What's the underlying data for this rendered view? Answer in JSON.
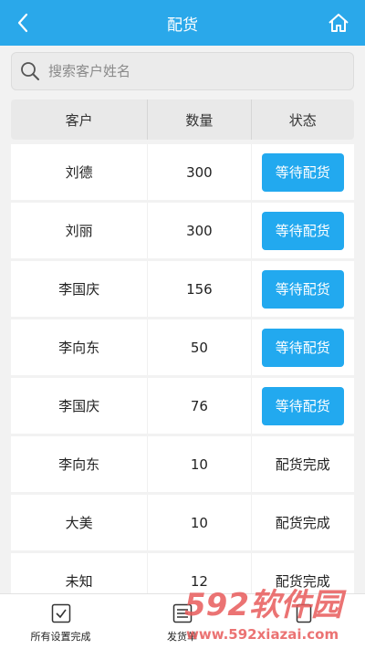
{
  "header": {
    "title": "配货"
  },
  "search": {
    "placeholder": "搜索客户姓名",
    "value": ""
  },
  "table": {
    "columns": [
      "客户",
      "数量",
      "状态"
    ],
    "rows": [
      {
        "customer": "刘德",
        "qty": "300",
        "status": "等待配货",
        "is_button": true
      },
      {
        "customer": "刘丽",
        "qty": "300",
        "status": "等待配货",
        "is_button": true
      },
      {
        "customer": "李国庆",
        "qty": "156",
        "status": "等待配货",
        "is_button": true
      },
      {
        "customer": "李向东",
        "qty": "50",
        "status": "等待配货",
        "is_button": true
      },
      {
        "customer": "李国庆",
        "qty": "76",
        "status": "等待配货",
        "is_button": true
      },
      {
        "customer": "李向东",
        "qty": "10",
        "status": "配货完成",
        "is_button": false
      },
      {
        "customer": "大美",
        "qty": "10",
        "status": "配货完成",
        "is_button": false
      },
      {
        "customer": "未知",
        "qty": "12",
        "status": "配货完成",
        "is_button": false
      }
    ]
  },
  "bottom_bar": {
    "items": [
      {
        "label": "所有设置完成",
        "icon": "checkbox-icon"
      },
      {
        "label": "发货单",
        "icon": "list-icon"
      },
      {
        "label": "",
        "icon": "doc-icon"
      }
    ]
  },
  "watermark": {
    "text": "592软件园",
    "url": "www.592xiazai.com"
  },
  "colors": {
    "header": "#2aa8ea",
    "accent_button": "#22a9ef",
    "watermark": "#e85a5a"
  }
}
